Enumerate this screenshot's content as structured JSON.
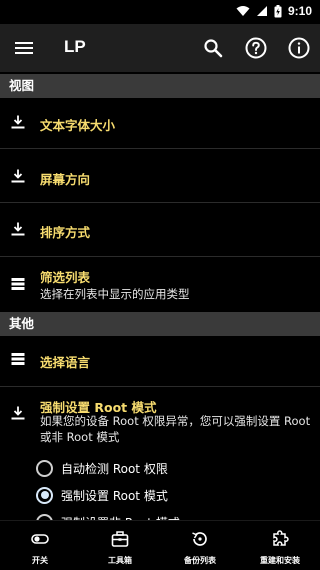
{
  "status": {
    "time": "9:10"
  },
  "app_bar": {
    "title": "LP"
  },
  "sections": [
    {
      "header": "视图"
    },
    {
      "header": "其他"
    }
  ],
  "view_items": [
    {
      "title": "文本字体大小",
      "icon": "download-icon"
    },
    {
      "title": "屏幕方向",
      "icon": "download-icon"
    },
    {
      "title": "排序方式",
      "icon": "download-icon"
    },
    {
      "title": "筛选列表",
      "subtitle": "选择在列表中显示的应用类型",
      "icon": "list-icon"
    }
  ],
  "other_items": [
    {
      "title": "选择语言",
      "icon": "list-icon"
    },
    {
      "title": "强制设置 Root 模式",
      "subtitle": "如果您的设备 Root 权限异常，您可以强制设置 Root 或非 Root 模式",
      "icon": "download-icon"
    }
  ],
  "root_options": [
    {
      "label": "自动检测 Root 权限",
      "checked": false
    },
    {
      "label": "强制设置 Root 模式",
      "checked": true
    },
    {
      "label": "强制设置非 Root 模式",
      "checked": false
    }
  ],
  "bottom_nav": [
    {
      "label": "开关",
      "icon": "toggle-icon"
    },
    {
      "label": "工具箱",
      "icon": "toolbox-icon"
    },
    {
      "label": "备份列表",
      "icon": "backup-icon"
    },
    {
      "label": "重建和安装",
      "icon": "puzzle-icon"
    }
  ],
  "colors": {
    "accent_title": "#f7dc6f",
    "section_bg": "#3a3a3a",
    "app_bar_bg": "#1f1f1f"
  }
}
